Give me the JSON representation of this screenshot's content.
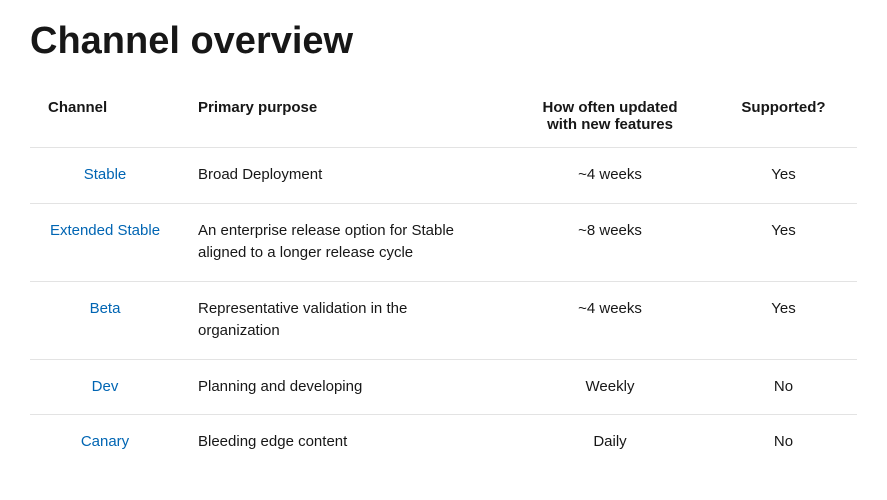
{
  "page": {
    "title": "Channel overview"
  },
  "table": {
    "headers": {
      "channel": "Channel",
      "purpose": "Primary purpose",
      "frequency": "How often updated with new features",
      "supported": "Supported?"
    },
    "rows": [
      {
        "channel": "Stable",
        "purpose": "Broad Deployment",
        "frequency": "~4 weeks",
        "supported": "Yes"
      },
      {
        "channel": "Extended Stable",
        "purpose": "An enterprise release option for Stable aligned to a longer release cycle",
        "frequency": "~8 weeks",
        "supported": "Yes"
      },
      {
        "channel": "Beta",
        "purpose": "Representative validation in the organization",
        "frequency": "~4 weeks",
        "supported": "Yes"
      },
      {
        "channel": "Dev",
        "purpose": "Planning and developing",
        "frequency": "Weekly",
        "supported": "No"
      },
      {
        "channel": "Canary",
        "purpose": "Bleeding edge content",
        "frequency": "Daily",
        "supported": "No"
      }
    ]
  }
}
